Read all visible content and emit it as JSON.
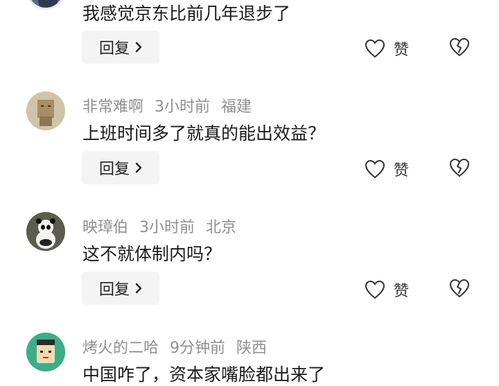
{
  "comments": [
    {
      "author": "",
      "time": "",
      "location": "",
      "text": "我感觉京东比前几年退步了",
      "reply_label": "回复",
      "like_label": "赞"
    },
    {
      "author": "非常难啊",
      "time": "3小时前",
      "location": "福建",
      "text": "上班时间多了就真的能出效益？",
      "reply_label": "回复",
      "like_label": "赞"
    },
    {
      "author": "映璋伯",
      "time": "3小时前",
      "location": "北京",
      "text": "这不就体制内吗？",
      "reply_label": "回复",
      "like_label": "赞"
    },
    {
      "author": "烤火的二哈",
      "time": "9分钟前",
      "location": "陕西",
      "text": "中国咋了，资本家嘴脸都出来了",
      "reply_label": "回复",
      "like_label": "赞"
    }
  ],
  "icons": {
    "like": "heart-outline-icon",
    "dislike": "broken-heart-icon",
    "reply_chevron": "chevron-right-icon"
  },
  "colors": {
    "meta_text": "#8f8f8f",
    "reply_bg": "#f4f4f4"
  }
}
